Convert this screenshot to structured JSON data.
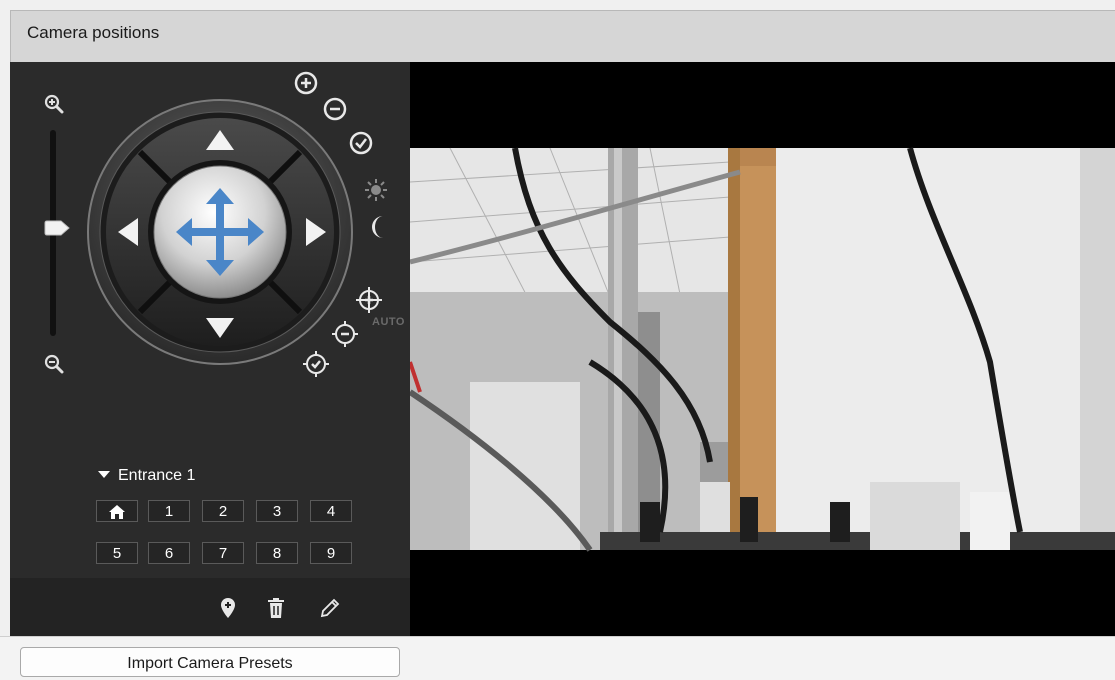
{
  "window": {
    "title": "Camera positions"
  },
  "ptz": {
    "zoom_in_icon": "zoom-in-icon",
    "zoom_out_icon": "zoom-out-icon",
    "slider_level": 0.4,
    "auto_label": "AUTO"
  },
  "presets": {
    "group_name": "Entrance 1",
    "home_icon": "home-icon",
    "row1": [
      "1",
      "2",
      "3",
      "4"
    ],
    "row2": [
      "5",
      "6",
      "7",
      "8",
      "9"
    ]
  },
  "footer_icons": [
    "add-location-icon",
    "delete-icon",
    "edit-icon"
  ],
  "import_button": {
    "label": "Import Camera Presets"
  },
  "colors": {
    "accent_arrow": "#4a86c8",
    "panel_bg": "#2b2b2b"
  }
}
